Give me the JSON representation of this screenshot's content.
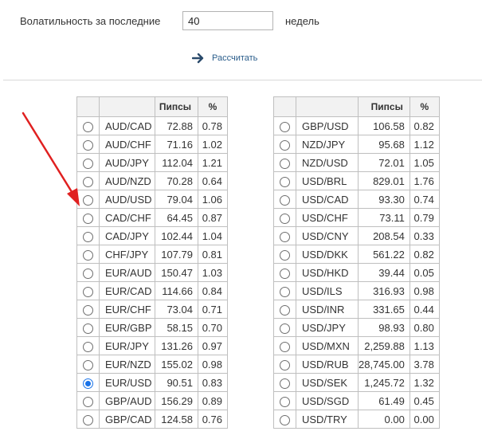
{
  "volatility": {
    "label": "Волатильность за последние",
    "weeks_value": "40",
    "unit_label": "недель",
    "calculate_label": "Рассчитать",
    "calculate_icon": "arrow-right-icon"
  },
  "table_headers": {
    "pips": "Пипсы",
    "percent": "%"
  },
  "accent_color": "#1a73e8",
  "annotation_color": "#e02020",
  "left_rows": [
    {
      "symbol": "AUD/CAD",
      "pips": "72.88",
      "percent": "0.78",
      "selected": false
    },
    {
      "symbol": "AUD/CHF",
      "pips": "71.16",
      "percent": "1.02",
      "selected": false
    },
    {
      "symbol": "AUD/JPY",
      "pips": "112.04",
      "percent": "1.21",
      "selected": false
    },
    {
      "symbol": "AUD/NZD",
      "pips": "70.28",
      "percent": "0.64",
      "selected": false
    },
    {
      "symbol": "AUD/USD",
      "pips": "79.04",
      "percent": "1.06",
      "selected": false
    },
    {
      "symbol": "CAD/CHF",
      "pips": "64.45",
      "percent": "0.87",
      "selected": false
    },
    {
      "symbol": "CAD/JPY",
      "pips": "102.44",
      "percent": "1.04",
      "selected": false
    },
    {
      "symbol": "CHF/JPY",
      "pips": "107.79",
      "percent": "0.81",
      "selected": false
    },
    {
      "symbol": "EUR/AUD",
      "pips": "150.47",
      "percent": "1.03",
      "selected": false
    },
    {
      "symbol": "EUR/CAD",
      "pips": "114.66",
      "percent": "0.84",
      "selected": false
    },
    {
      "symbol": "EUR/CHF",
      "pips": "73.04",
      "percent": "0.71",
      "selected": false
    },
    {
      "symbol": "EUR/GBP",
      "pips": "58.15",
      "percent": "0.70",
      "selected": false
    },
    {
      "symbol": "EUR/JPY",
      "pips": "131.26",
      "percent": "0.97",
      "selected": false
    },
    {
      "symbol": "EUR/NZD",
      "pips": "155.02",
      "percent": "0.98",
      "selected": false
    },
    {
      "symbol": "EUR/USD",
      "pips": "90.51",
      "percent": "0.83",
      "selected": true
    },
    {
      "symbol": "GBP/AUD",
      "pips": "156.29",
      "percent": "0.89",
      "selected": false
    },
    {
      "symbol": "GBP/CAD",
      "pips": "124.58",
      "percent": "0.76",
      "selected": false
    }
  ],
  "right_rows": [
    {
      "symbol": "GBP/USD",
      "pips": "106.58",
      "percent": "0.82",
      "selected": false
    },
    {
      "symbol": "NZD/JPY",
      "pips": "95.68",
      "percent": "1.12",
      "selected": false
    },
    {
      "symbol": "NZD/USD",
      "pips": "72.01",
      "percent": "1.05",
      "selected": false
    },
    {
      "symbol": "USD/BRL",
      "pips": "829.01",
      "percent": "1.76",
      "selected": false
    },
    {
      "symbol": "USD/CAD",
      "pips": "93.30",
      "percent": "0.74",
      "selected": false
    },
    {
      "symbol": "USD/CHF",
      "pips": "73.11",
      "percent": "0.79",
      "selected": false
    },
    {
      "symbol": "USD/CNY",
      "pips": "208.54",
      "percent": "0.33",
      "selected": false
    },
    {
      "symbol": "USD/DKK",
      "pips": "561.22",
      "percent": "0.82",
      "selected": false
    },
    {
      "symbol": "USD/HKD",
      "pips": "39.44",
      "percent": "0.05",
      "selected": false
    },
    {
      "symbol": "USD/ILS",
      "pips": "316.93",
      "percent": "0.98",
      "selected": false
    },
    {
      "symbol": "USD/INR",
      "pips": "331.65",
      "percent": "0.44",
      "selected": false
    },
    {
      "symbol": "USD/JPY",
      "pips": "98.93",
      "percent": "0.80",
      "selected": false
    },
    {
      "symbol": "USD/MXN",
      "pips": "2,259.88",
      "percent": "1.13",
      "selected": false
    },
    {
      "symbol": "USD/RUB",
      "pips": "28,745.00",
      "percent": "3.78",
      "selected": false
    },
    {
      "symbol": "USD/SEK",
      "pips": "1,245.72",
      "percent": "1.32",
      "selected": false
    },
    {
      "symbol": "USD/SGD",
      "pips": "61.49",
      "percent": "0.45",
      "selected": false
    },
    {
      "symbol": "USD/TRY",
      "pips": "0.00",
      "percent": "0.00",
      "selected": false
    }
  ]
}
